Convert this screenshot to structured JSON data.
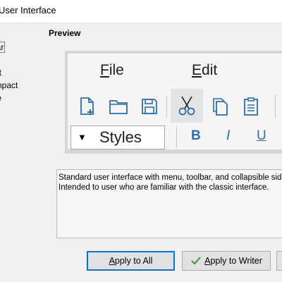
{
  "window": {
    "title": "User Interface"
  },
  "options": [
    {
      "label": "bar",
      "selected": true
    },
    {
      "label": "act",
      "selected": false
    },
    {
      "label": "ompact",
      "selected": false
    },
    {
      "label": "gle",
      "selected": false
    }
  ],
  "preview": {
    "heading": "Preview",
    "menu": {
      "file_first": "F",
      "file_rest": "ile",
      "edit_first": "E",
      "edit_rest": "dit"
    },
    "toolbar_icons": [
      "new-document-icon",
      "open-folder-icon",
      "save-icon",
      "cut-icon",
      "copy-icon",
      "paste-icon"
    ],
    "styles_arrow": "▼",
    "styles_label": "Styles",
    "bold": "B",
    "italic": "I",
    "underline": "U",
    "accent_color": "#2a6fb0"
  },
  "description": {
    "line1": "Standard user interface with menu, toolbar, and collapsible sidebar.",
    "line2": "Intended to user who are familiar with the classic interface."
  },
  "buttons": {
    "apply_all_first": "A",
    "apply_all_rest": "pply to All",
    "apply_writer_prefix": "",
    "apply_writer_first": "A",
    "apply_writer_rest": "pply to Writer"
  }
}
